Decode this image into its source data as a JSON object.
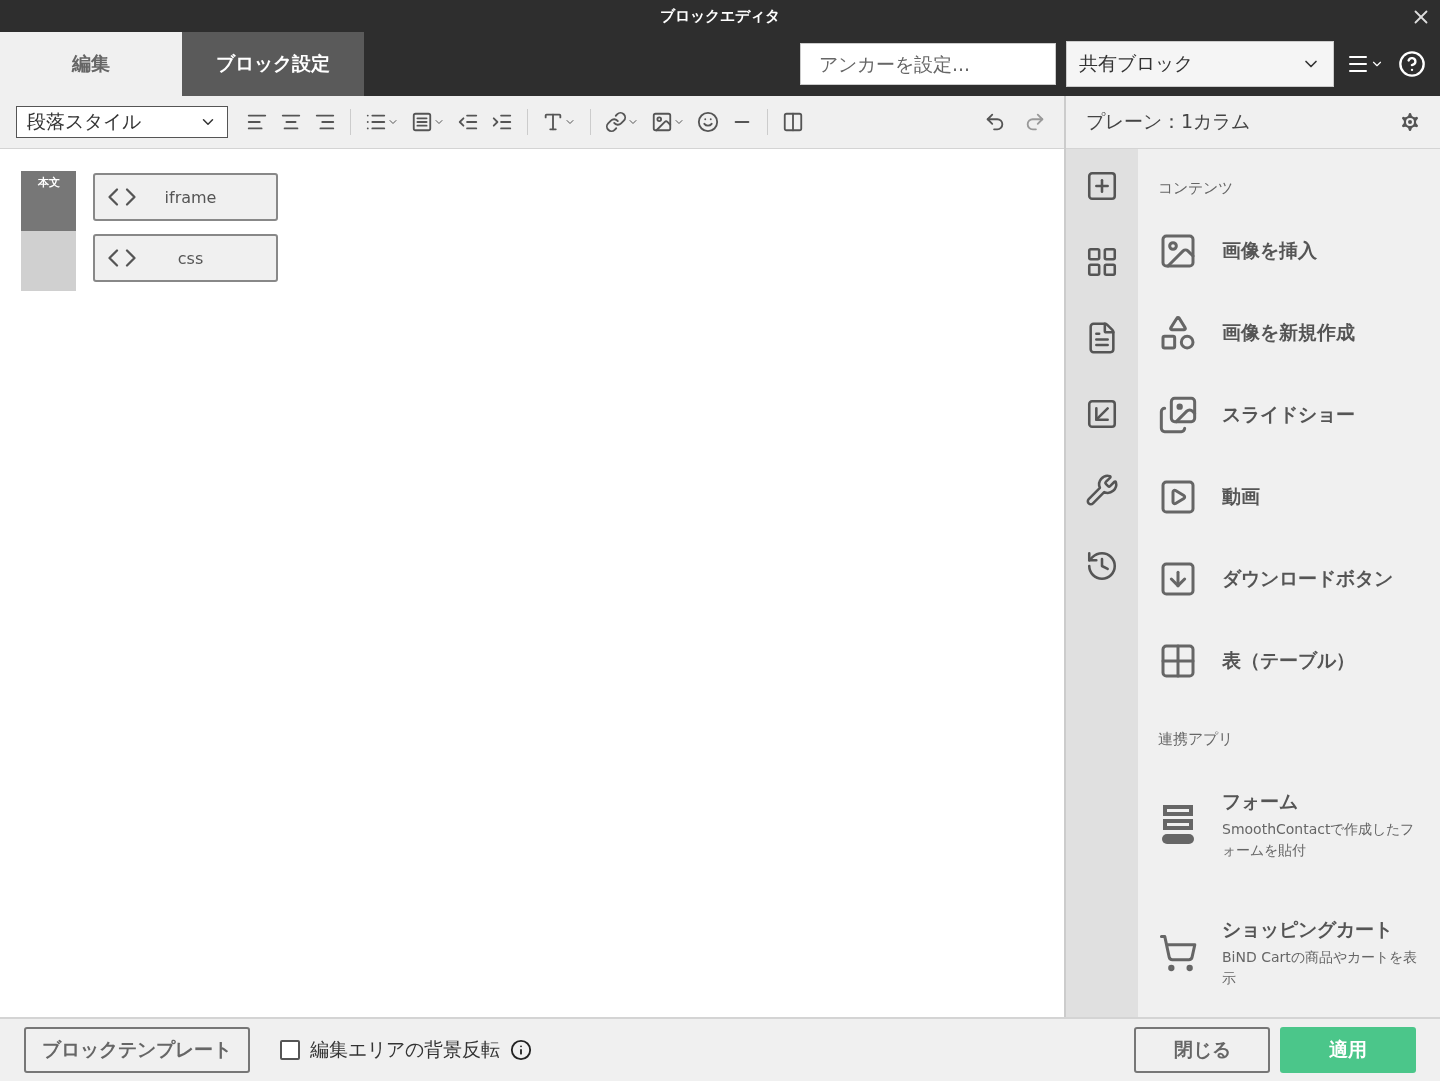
{
  "window": {
    "title": "ブロックエディタ"
  },
  "tabs": [
    {
      "label": "編集",
      "selected": true
    },
    {
      "label": "ブロック設定",
      "selected": false
    }
  ],
  "anchor_field": {
    "placeholder": "アンカーを設定..."
  },
  "shared_block_select": {
    "value": "共有ブロック"
  },
  "toolbar": {
    "paragraph_style": "段落スタイル"
  },
  "editor": {
    "section_label": "本文",
    "blocks": [
      {
        "label": "iframe"
      },
      {
        "label": "css"
      }
    ]
  },
  "panel": {
    "title": "プレーン：1カラム",
    "sections": [
      {
        "heading": "コンテンツ",
        "items": [
          {
            "label": "画像を挿入"
          },
          {
            "label": "画像を新規作成"
          },
          {
            "label": "スライドショー"
          },
          {
            "label": "動画"
          },
          {
            "label": "ダウンロードボタン"
          },
          {
            "label": "表（テーブル）"
          }
        ]
      },
      {
        "heading": "連携アプリ",
        "items": [
          {
            "label": "フォーム",
            "description": "SmoothContactで作成したフォームを貼付"
          },
          {
            "label": "ショッピングカート",
            "description": "BiND Cartの商品やカートを表示"
          }
        ]
      }
    ]
  },
  "footer": {
    "template_button": "ブロックテンプレート",
    "invert_checkbox": {
      "label": "編集エリアの背景反転",
      "checked": false
    },
    "buttons": [
      {
        "label": "閉じる",
        "kind": "secondary"
      },
      {
        "label": "適用",
        "kind": "primary"
      }
    ]
  }
}
